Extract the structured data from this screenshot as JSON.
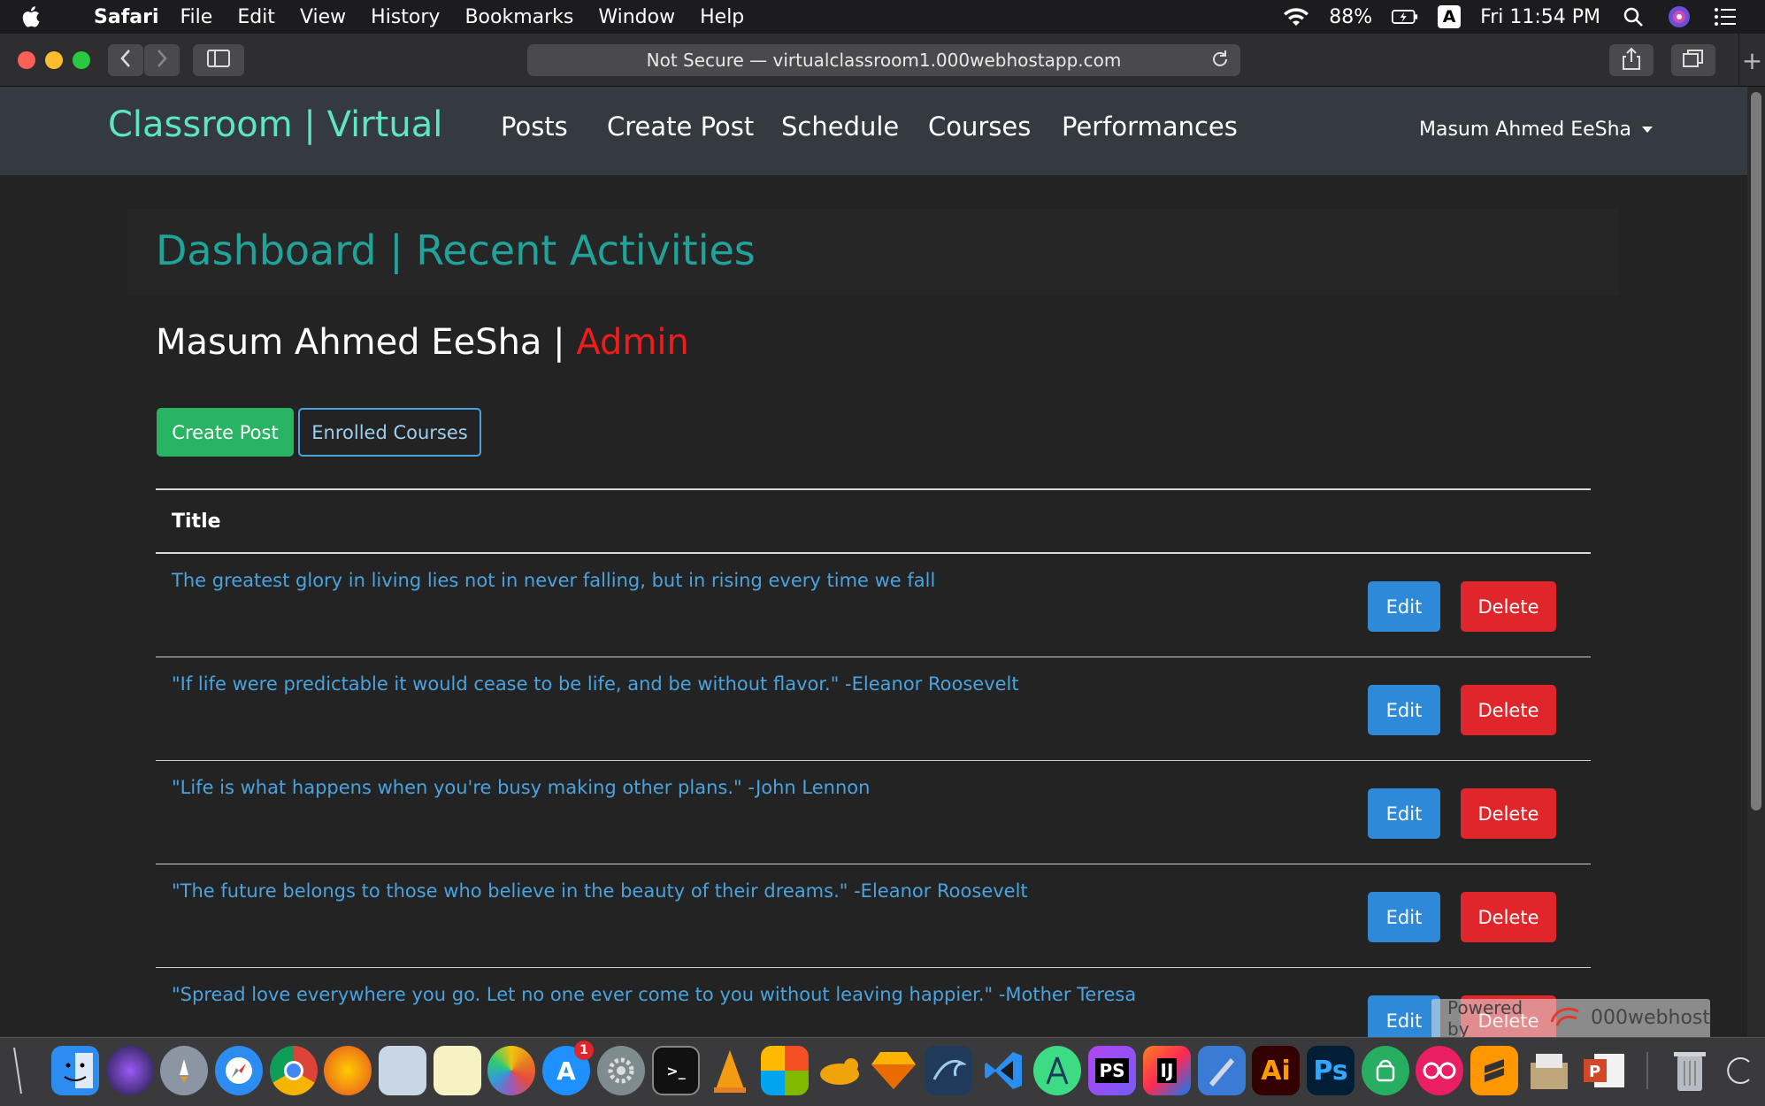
{
  "menubar": {
    "app": "Safari",
    "menus": [
      "File",
      "Edit",
      "View",
      "History",
      "Bookmarks",
      "Window",
      "Help"
    ],
    "battery": "88%",
    "input_source": "A",
    "clock": "Fri 11:54 PM"
  },
  "browser": {
    "address": "Not Secure — virtualclassroom1.000webhostapp.com"
  },
  "site": {
    "brand": "Classroom | Virtual",
    "nav": [
      "Posts",
      "Create Post",
      "Schedule",
      "Courses",
      "Performances"
    ],
    "user": "Masum Ahmed EeSha"
  },
  "dashboard": {
    "title": "Dashboard | Recent Activities",
    "user_name": "Masum Ahmed EeSha",
    "separator": " | ",
    "role": "Admin",
    "create_btn": "Create Post",
    "enrolled_btn": "Enrolled Courses",
    "table_header": "Title",
    "edit_label": "Edit",
    "delete_label": "Delete",
    "posts": [
      "The greatest glory in living lies not in never falling, but in rising every time we fall",
      "\"If life were predictable it would cease to be life, and be without flavor.\" -Eleanor Roosevelt",
      "\"Life is what happens when you're busy making other plans.\" -John Lennon",
      "\"The future belongs to those who believe in the beauty of their dreams.\" -Eleanor Roosevelt",
      "\"Spread love everywhere you go. Let no one ever come to you without leaving happier.\" -Mother Teresa"
    ]
  },
  "banner": {
    "powered_by": "Powered by",
    "host": "000webhost"
  },
  "dock": {
    "badge_count": "1",
    "labels": [
      "PS",
      "IJ",
      "Ai",
      "Ps"
    ]
  }
}
